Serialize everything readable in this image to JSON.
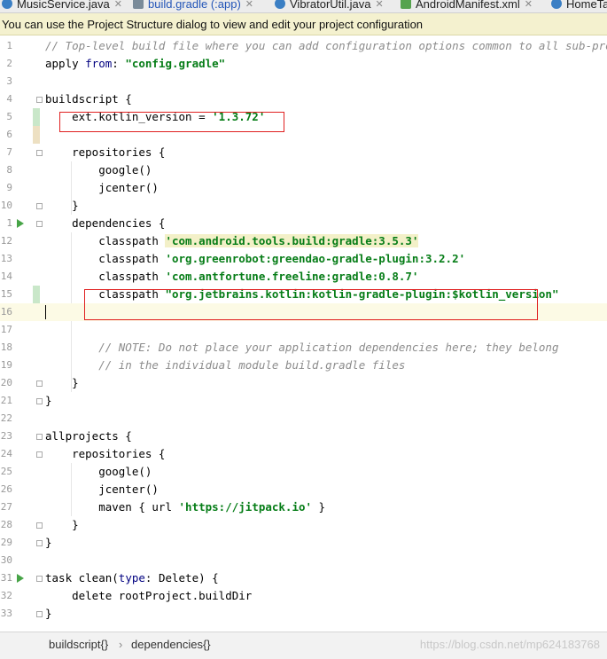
{
  "tabs": [
    {
      "label": "MusicService.java",
      "icon": "class-icon",
      "active": false
    },
    {
      "label": "build.gradle (:app)",
      "icon": "gradle-icon",
      "active": true
    },
    {
      "label": "VibratorUtil.java",
      "icon": "class-icon",
      "active": false
    },
    {
      "label": "AndroidManifest.xml",
      "icon": "manifest-icon",
      "active": false
    },
    {
      "label": "HomeTa",
      "icon": "class-icon",
      "active": false
    }
  ],
  "banner": {
    "text": "You can use the Project Structure dialog to view and edit your project configuration"
  },
  "lines": [
    {
      "n": "1",
      "t": "// Top-level build file where you can add configuration options common to all sub-projects/"
    },
    {
      "n": "2",
      "t": "apply from: \"config.gradle\""
    },
    {
      "n": "3",
      "t": ""
    },
    {
      "n": "4",
      "t": "buildscript {"
    },
    {
      "n": "5",
      "t": "    ext.kotlin_version = '1.3.72'"
    },
    {
      "n": "6",
      "t": ""
    },
    {
      "n": "7",
      "t": "    repositories {"
    },
    {
      "n": "8",
      "t": "        google()"
    },
    {
      "n": "9",
      "t": "        jcenter()"
    },
    {
      "n": "10",
      "t": "    }"
    },
    {
      "n": "1",
      "t": "    dependencies {"
    },
    {
      "n": "12",
      "t": "        classpath 'com.android.tools.build:gradle:3.5.3'"
    },
    {
      "n": "13",
      "t": "        classpath 'org.greenrobot:greendao-gradle-plugin:3.2.2'"
    },
    {
      "n": "14",
      "t": "        classpath 'com.antfortune.freeline:gradle:0.8.7'"
    },
    {
      "n": "15",
      "t": "        classpath \"org.jetbrains.kotlin:kotlin-gradle-plugin:$kotlin_version\""
    },
    {
      "n": "16",
      "t": ""
    },
    {
      "n": "17",
      "t": ""
    },
    {
      "n": "18",
      "t": "        // NOTE: Do not place your application dependencies here; they belong"
    },
    {
      "n": "19",
      "t": "        // in the individual module build.gradle files"
    },
    {
      "n": "20",
      "t": "    }"
    },
    {
      "n": "21",
      "t": "}"
    },
    {
      "n": "22",
      "t": ""
    },
    {
      "n": "23",
      "t": "allprojects {"
    },
    {
      "n": "24",
      "t": "    repositories {"
    },
    {
      "n": "25",
      "t": "        google()"
    },
    {
      "n": "26",
      "t": "        jcenter()"
    },
    {
      "n": "27",
      "t": "        maven { url 'https://jitpack.io' }"
    },
    {
      "n": "28",
      "t": "    }"
    },
    {
      "n": "29",
      "t": "}"
    },
    {
      "n": "30",
      "t": ""
    },
    {
      "n": "31",
      "t": "task clean(type: Delete) {"
    },
    {
      "n": "32",
      "t": "    delete rootProject.buildDir"
    },
    {
      "n": "33",
      "t": "}"
    }
  ],
  "breadcrumb": {
    "items": [
      "buildscript{}",
      "dependencies{}"
    ],
    "separator": "›"
  },
  "watermark": "https://blog.csdn.net/mp624183768",
  "colors": {
    "comment": "#8c8c8c",
    "string": "#067d17",
    "keyword": "#000080",
    "annotation_box": "#e02020",
    "banner_bg": "#f4f1cf",
    "run_icon": "#47a447"
  }
}
